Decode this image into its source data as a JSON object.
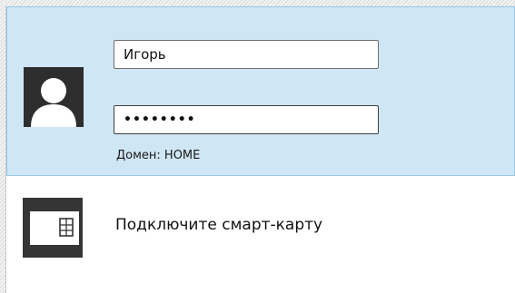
{
  "account": {
    "username_value": "Игорь",
    "password_value": "••••••••",
    "domain_label": "Домен: HOME",
    "avatar_icon": "user-silhouette-icon"
  },
  "smartcard": {
    "label": "Подключите смарт-карту",
    "icon": "smart-card-icon"
  },
  "colors": {
    "selected_tile_background": "#cfe6f4",
    "selected_tile_border": "#99c8e6",
    "icon_tile_background": "#2e2e2e",
    "icon_foreground": "#ffffff"
  }
}
